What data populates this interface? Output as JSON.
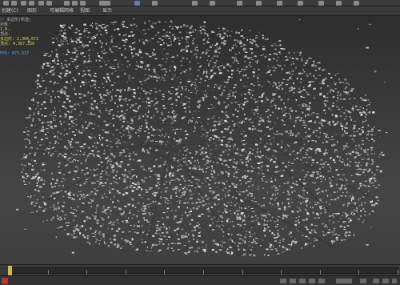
{
  "menu": {
    "items": [
      "创建(C)",
      "图形",
      "可编辑网格",
      "视图",
      "显示"
    ]
  },
  "stats": {
    "lines": [
      {
        "text": "ⓘ 多边形(所选)",
        "color": "white"
      },
      {
        "text": "对象:",
        "color": "white"
      },
      {
        "text": "1.8..",
        "color": "yellow"
      },
      {
        "text": "顶点:",
        "color": "white"
      },
      {
        "text": "多边形: 2,304,672",
        "color": "yellow"
      },
      {
        "text": "顶点: 4,367,226",
        "color": "yellow"
      },
      {
        "text": "",
        "color": "white"
      },
      {
        "text": "FPS: 875.617",
        "color": "blue"
      }
    ]
  },
  "timeline": {
    "current_frame": 0,
    "ticks": [
      "0",
      "10",
      "20",
      "30",
      "40",
      "50",
      "60",
      "70",
      "80",
      "90",
      "100"
    ]
  },
  "colors": {
    "toolbar": "#3c3c3c",
    "viewport_bg": "#3d3d3d",
    "buildings": "#d8d8d8",
    "slider": "#d9b64a"
  }
}
